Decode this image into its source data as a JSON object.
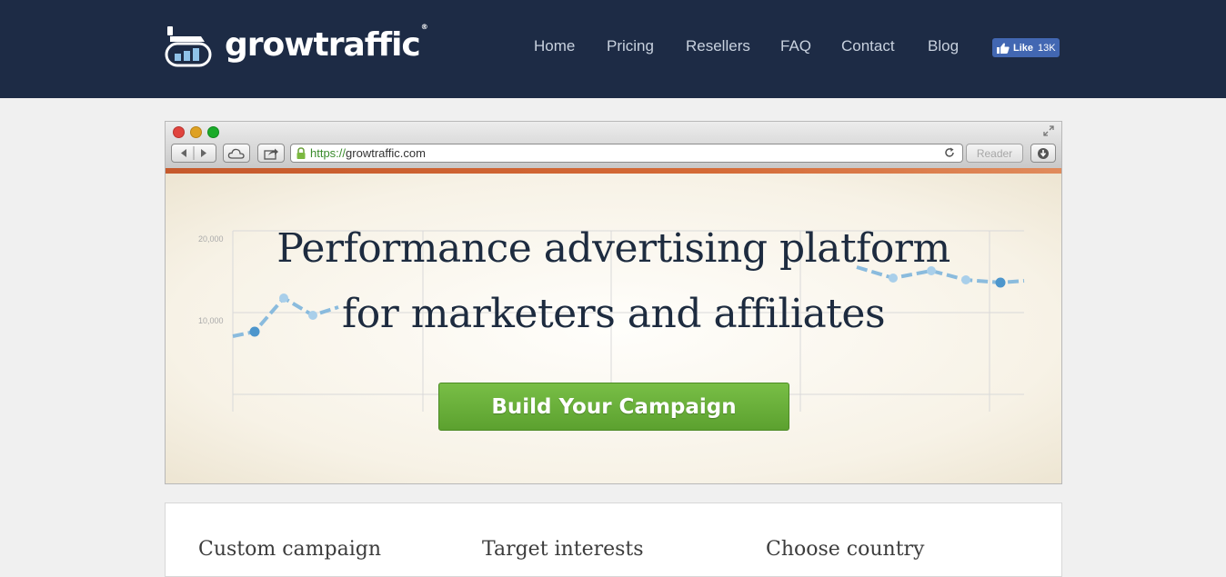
{
  "header": {
    "brand": "growtraffic",
    "brand_mark": "®",
    "nav": [
      "Home",
      "Pricing",
      "Resellers",
      "FAQ",
      "Contact",
      "Blog"
    ],
    "like": {
      "label": "Like",
      "count": "13K"
    }
  },
  "browser": {
    "url_scheme": "https://",
    "url_host": "growtraffic.com",
    "reader_label": "Reader"
  },
  "hero": {
    "chart_ticks": [
      "20,000",
      "10,000"
    ],
    "title_line1": "Performance advertising platform",
    "title_line2": "for marketers and affiliates",
    "cta_label": "Build Your Campaign"
  },
  "features": [
    "Custom campaign",
    "Target interests",
    "Choose country"
  ],
  "colors": {
    "header_bg": "#1d2b45",
    "cta_green": "#6ab33a",
    "facebook_blue": "#4267b2",
    "accent_stripe": "#c65a2c"
  }
}
